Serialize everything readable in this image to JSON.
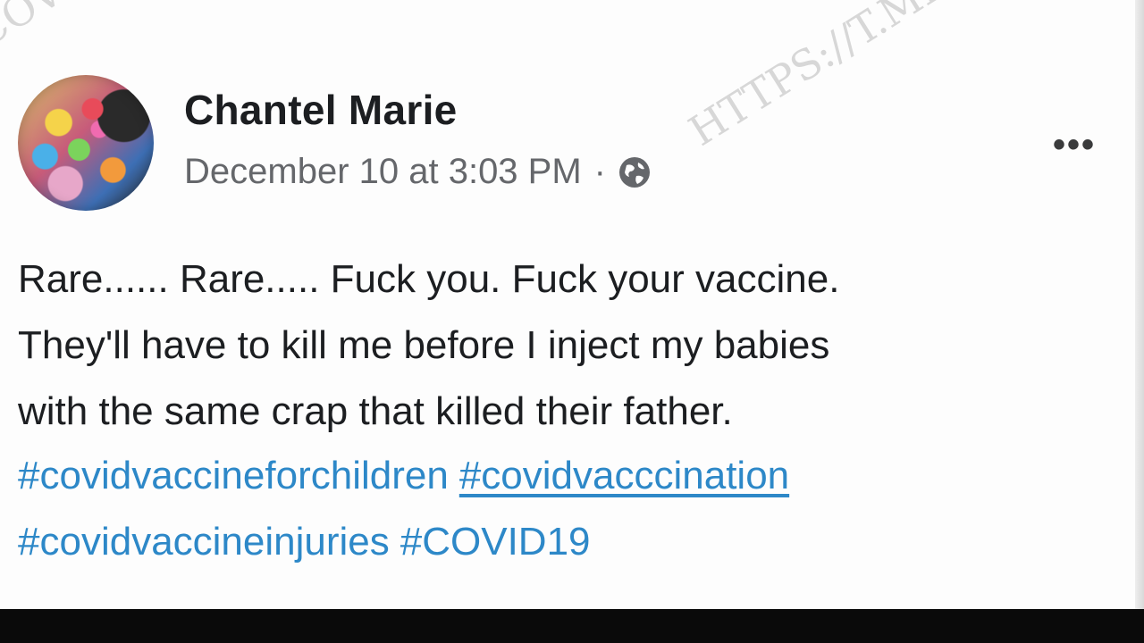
{
  "post": {
    "author": "Chantel Marie",
    "timestamp": "December 10 at 3:03 PM",
    "separator": "·",
    "audience_icon": "globe-icon",
    "more_label": "•••",
    "body_lines": [
      "Rare...... Rare..... Fuck you. Fuck your vaccine.",
      "They'll have to kill me before I inject my babies",
      "with the same crap that killed their father."
    ],
    "hashtags": [
      "#covidvaccineforchildren",
      "#covidvacccination",
      "#covidvaccineinjuries",
      "#COVID19"
    ]
  },
  "watermark": {
    "main": "HTTPS://T.ME/C",
    "corner": "COVID"
  },
  "colors": {
    "hashtag": "#2d88c8",
    "text": "#1c1e21",
    "meta": "#65676b",
    "bottom_bar": "#0a0a0a"
  }
}
